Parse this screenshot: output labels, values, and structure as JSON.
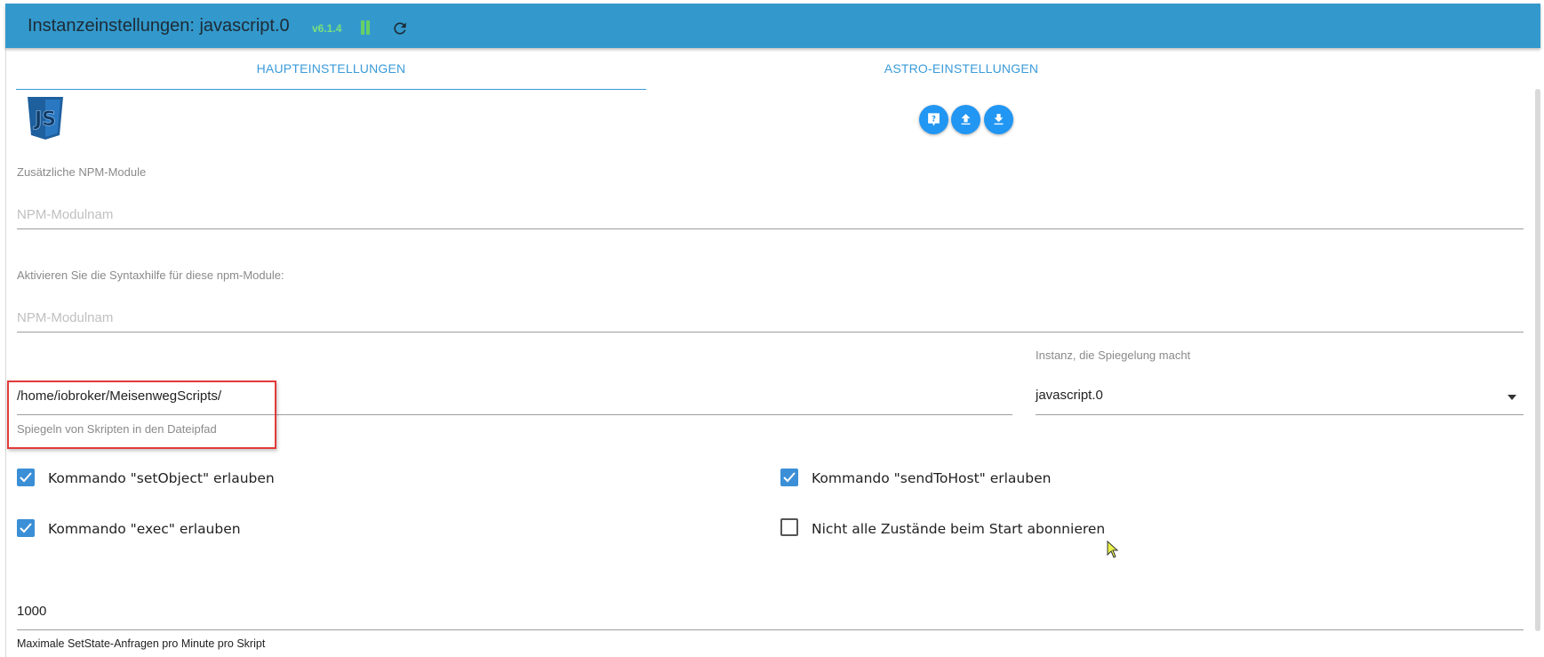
{
  "header": {
    "title": "Instanzeinstellungen: javascript.0",
    "version": "v6.1.4",
    "pause_icon": "pause-icon",
    "reload_icon": "reload-icon",
    "accent": "#3399cc"
  },
  "tabs": [
    {
      "label": "HAUPTEINSTELLUNGEN",
      "active": true
    },
    {
      "label": "ASTRO-EINSTELLUNGEN",
      "active": false
    }
  ],
  "logo": {
    "icon": "javascript-logo-icon",
    "text": "JS"
  },
  "actions": [
    {
      "icon": "help-icon"
    },
    {
      "icon": "upload-icon"
    },
    {
      "icon": "download-icon"
    }
  ],
  "npm_modules": {
    "label": "Zusätzliche NPM-Module",
    "placeholder": "NPM-Modulnam",
    "value": ""
  },
  "syntax_help": {
    "label": "Aktivieren Sie die Syntaxhilfe für diese npm-Module:",
    "placeholder": "NPM-Modulnam",
    "value": ""
  },
  "mirror_path": {
    "value": "/home/iobroker/MeisenwegScripts/",
    "helper": "Spiegeln von Skripten in den Dateipfad"
  },
  "mirror_instance": {
    "label": "Instanz, die Spiegelung macht",
    "value": "javascript.0"
  },
  "checkboxes": [
    {
      "label": "Kommando \"setObject\" erlauben",
      "checked": true
    },
    {
      "label": "Kommando \"sendToHost\" erlauben",
      "checked": true
    },
    {
      "label": "Kommando \"exec\" erlauben",
      "checked": true
    },
    {
      "label": "Nicht alle Zustände beim Start abonnieren",
      "checked": false
    }
  ],
  "max_setstate": {
    "value": "1000",
    "helper": "Maximale SetState-Anfragen pro Minute pro Skript"
  }
}
